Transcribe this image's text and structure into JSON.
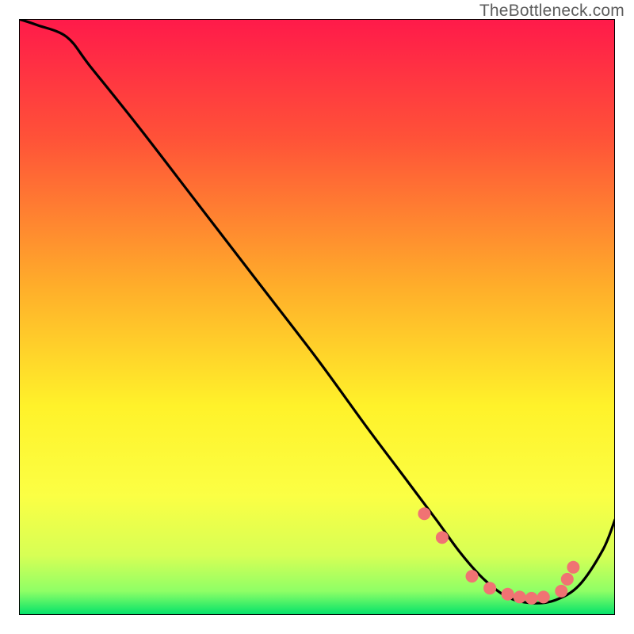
{
  "watermark": "TheBottleneck.com",
  "chart_data": {
    "type": "line",
    "title": "",
    "xlabel": "",
    "ylabel": "",
    "xlim": [
      0,
      100
    ],
    "ylim": [
      0,
      100
    ],
    "grid": false,
    "legend": false,
    "background_gradient_stops": [
      {
        "offset": 0,
        "color": "#ff1a4a"
      },
      {
        "offset": 20,
        "color": "#ff5238"
      },
      {
        "offset": 45,
        "color": "#ffae2a"
      },
      {
        "offset": 65,
        "color": "#fff22a"
      },
      {
        "offset": 80,
        "color": "#fbff44"
      },
      {
        "offset": 90,
        "color": "#d7ff55"
      },
      {
        "offset": 96,
        "color": "#8fff66"
      },
      {
        "offset": 100,
        "color": "#00e26a"
      }
    ],
    "series": [
      {
        "name": "bottleneck-curve",
        "color": "#000000",
        "x": [
          0,
          3,
          8,
          12,
          20,
          30,
          40,
          50,
          58,
          64,
          70,
          74,
          78,
          82,
          86,
          90,
          94,
          98,
          100
        ],
        "y": [
          100,
          99,
          97,
          92,
          82,
          69,
          56,
          43,
          32,
          24,
          16,
          10.5,
          6,
          3,
          2,
          2.5,
          5,
          11,
          16
        ]
      }
    ],
    "markers": {
      "name": "highlight-dots",
      "color": "#f07373",
      "radius": 8,
      "x": [
        68,
        71,
        76,
        79,
        82,
        84,
        86,
        88,
        91,
        92,
        93
      ],
      "y": [
        17,
        13,
        6.5,
        4.5,
        3.5,
        3,
        2.8,
        3,
        4,
        6,
        8
      ]
    }
  }
}
